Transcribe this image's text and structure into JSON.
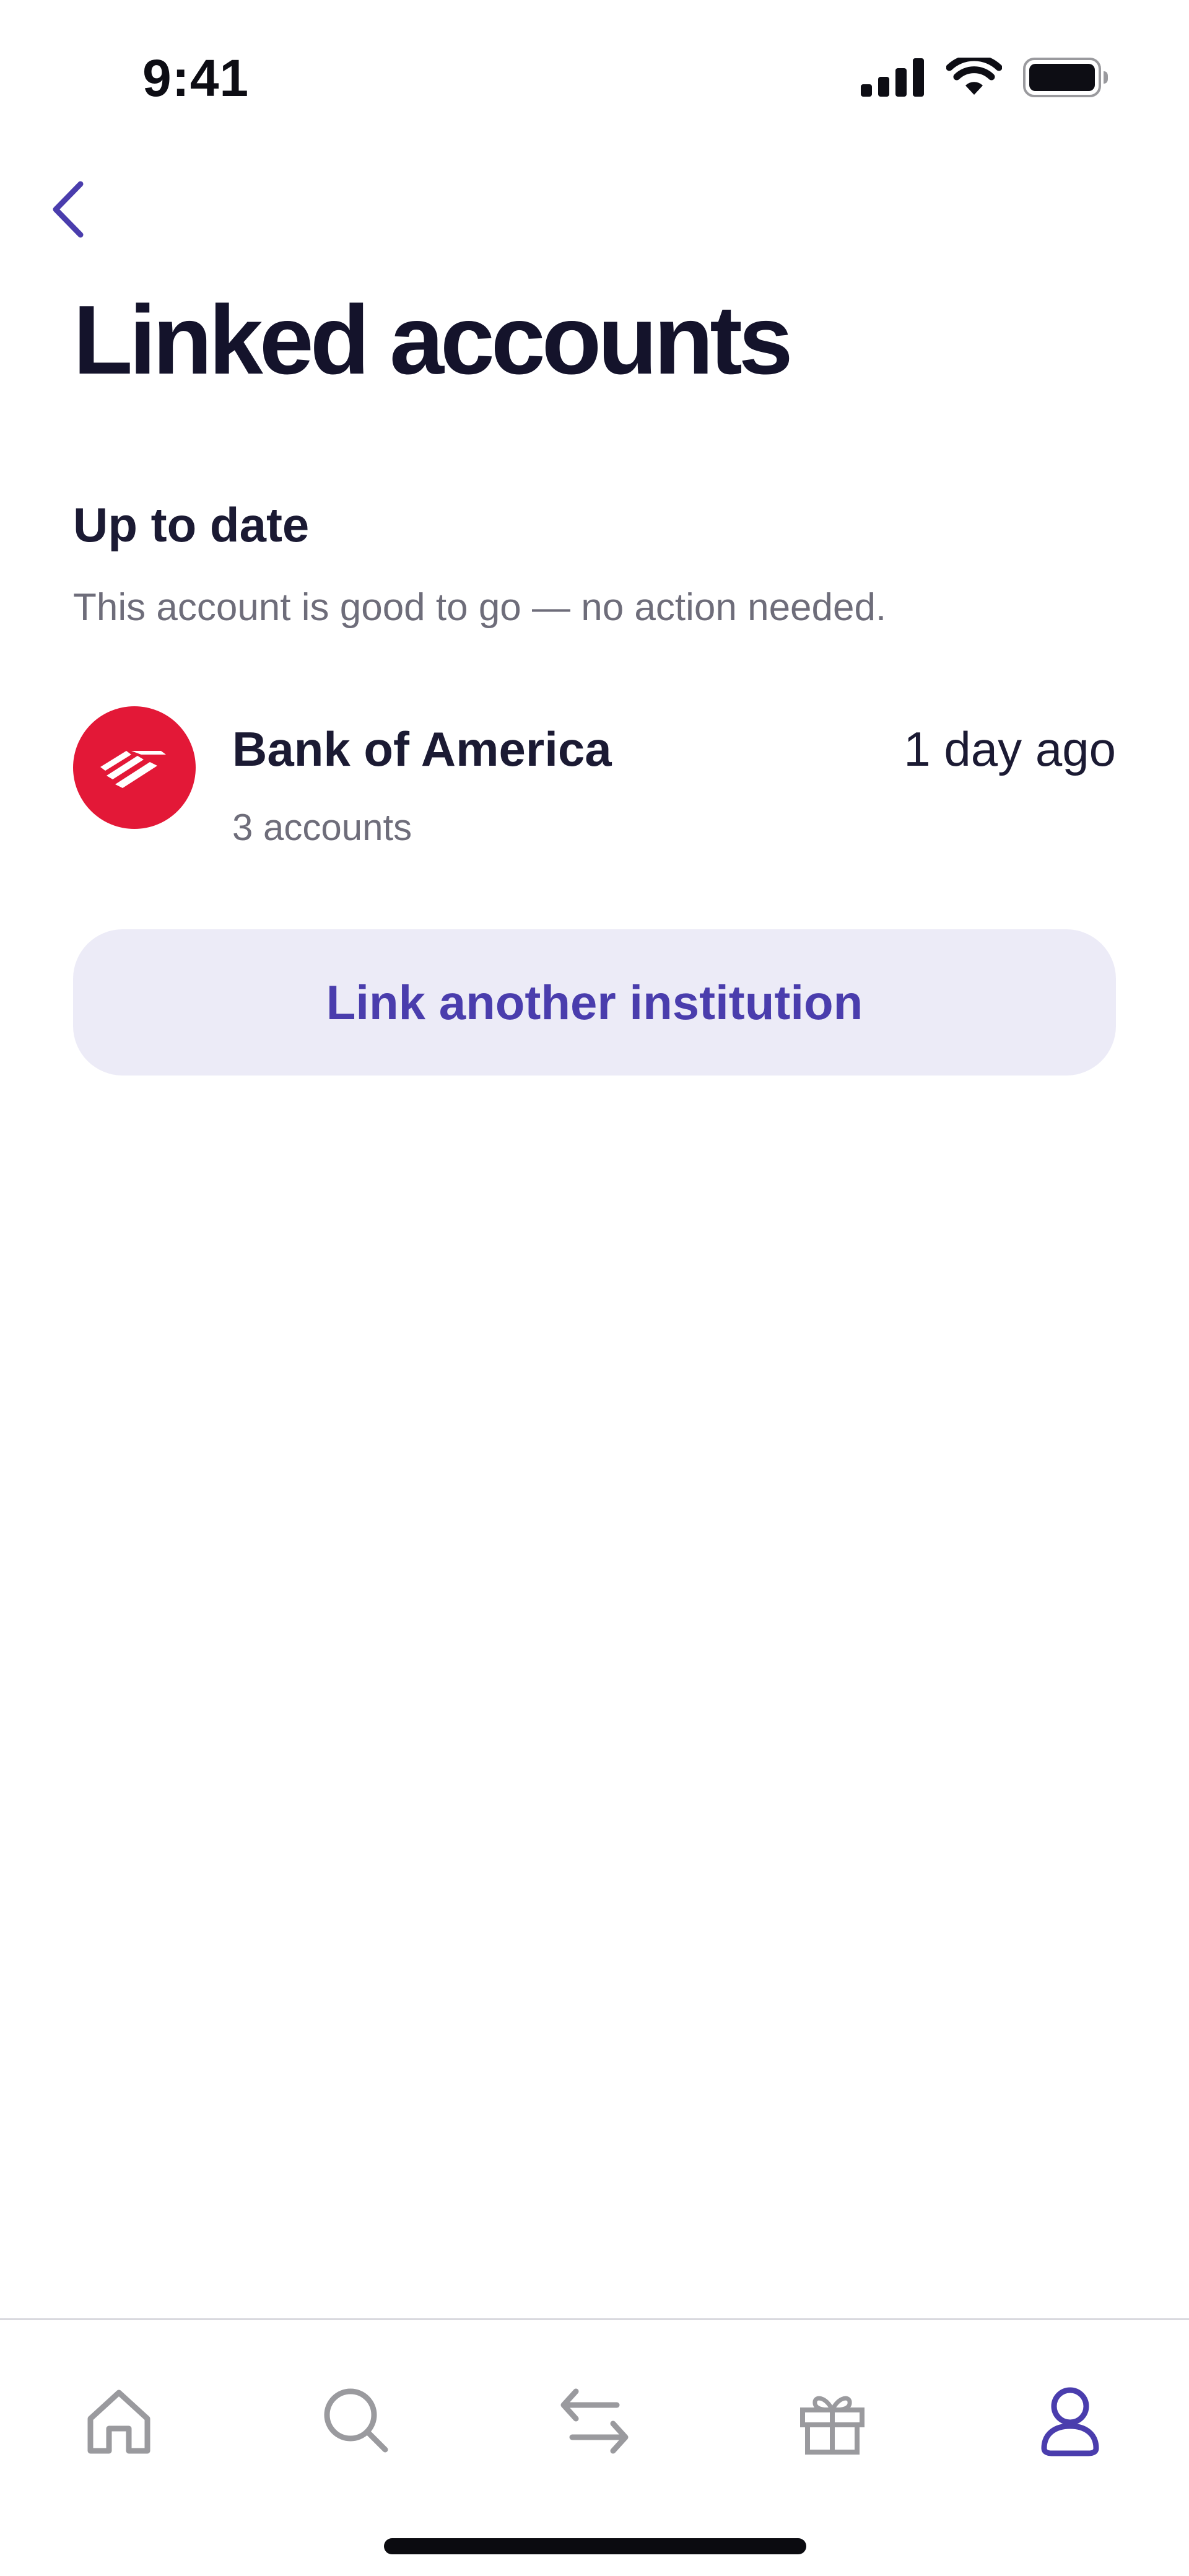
{
  "status_bar": {
    "time": "9:41",
    "icons": [
      "cellular-signal-icon",
      "wifi-icon",
      "battery-icon"
    ]
  },
  "header": {
    "back_icon": "chevron-left-icon",
    "title": "Linked accounts"
  },
  "section": {
    "title": "Up to date",
    "description": "This account is good to go — no action needed."
  },
  "accounts": [
    {
      "name": "Bank of America",
      "subtitle": "3 accounts",
      "updated": "1 day ago",
      "logo_icon": "bank-of-america-logo-icon",
      "logo_color": "#e31837"
    }
  ],
  "link_button": {
    "label": "Link another institution"
  },
  "bottom_nav": {
    "items": [
      {
        "icon": "home-icon",
        "active": false
      },
      {
        "icon": "search-icon",
        "active": false
      },
      {
        "icon": "transfer-icon",
        "active": false
      },
      {
        "icon": "gift-icon",
        "active": false
      },
      {
        "icon": "profile-icon",
        "active": true
      }
    ]
  },
  "colors": {
    "accent": "#4a3dad",
    "accent_light": "#ecebf7",
    "text_primary": "#1b1a33",
    "text_secondary": "#6e6d7a",
    "nav_inactive": "#9a9a9e",
    "nav_active": "#4a3dad"
  }
}
